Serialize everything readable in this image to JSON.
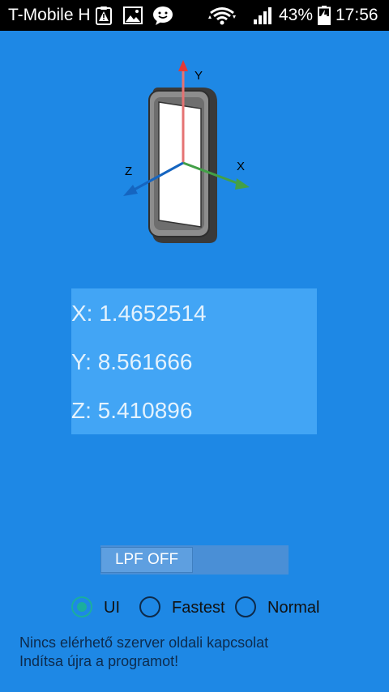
{
  "status_bar": {
    "carrier": "T-Mobile H",
    "battery_percent": "43%",
    "time": "17:56"
  },
  "axis_figure": {
    "y_label": "Y",
    "x_label": "X",
    "z_label": "Z"
  },
  "readout": {
    "x": "X: 1.4652514",
    "y": "Y: 8.561666",
    "z": "Z: 5.410896"
  },
  "lpf_toggle": {
    "label": "LPF OFF",
    "state": "off"
  },
  "sensor_rate": {
    "options": [
      "UI",
      "Fastest",
      "Normal"
    ],
    "selected": "UI"
  },
  "message": {
    "line1": "Nincs elérhető szerver oldali kapcsolat",
    "line2": "Indítsa újra a programot!"
  },
  "colors": {
    "background": "#1E88E5",
    "panel": "#42A5F5",
    "accent": "#1AAE9F",
    "axis_y": "#E53935",
    "axis_x": "#43A047",
    "axis_z": "#1565C0"
  }
}
